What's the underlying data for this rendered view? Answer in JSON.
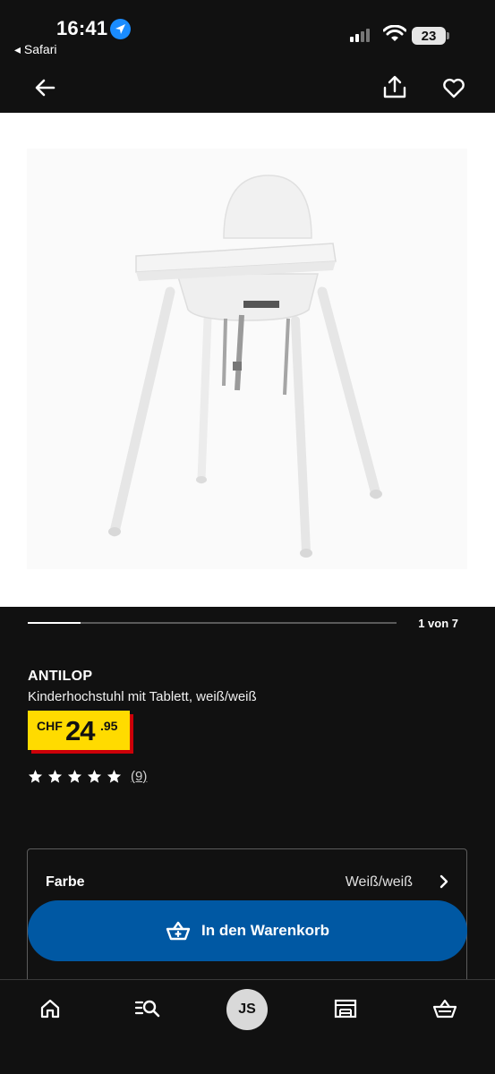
{
  "status_bar": {
    "time": "16:41",
    "back_app": "◂ Safari",
    "battery_level": "23",
    "icons": [
      "location-icon",
      "signal-icon",
      "wifi-icon",
      "battery-icon"
    ]
  },
  "top_nav": {
    "icons": [
      "back-arrow-icon",
      "share-icon",
      "heart-icon"
    ]
  },
  "gallery": {
    "image_subject": "white children's high chair with tray",
    "current_index": 1,
    "total": 7,
    "counter_text": "1 von 7",
    "progress_fraction": 0.143
  },
  "product": {
    "name": "ANTILOP",
    "description": "Kinderhochstuhl mit Tablett, weiß/weiß",
    "price": {
      "currency": "CHF",
      "integer": "24",
      "decimal": ".95"
    },
    "rating": {
      "stars": 5,
      "review_count": "(9)"
    }
  },
  "options": {
    "color_label": "Farbe",
    "color_value": "Weiß/weiß"
  },
  "cart_button": {
    "label": "In den Warenkorb",
    "icon": "basket-plus-icon"
  },
  "bottom_nav": {
    "avatar_initials": "JS",
    "items": [
      "home-icon",
      "search-menu-icon",
      "avatar",
      "store-icon",
      "basket-icon"
    ]
  },
  "colors": {
    "background": "#111111",
    "price_yellow": "#ffdb00",
    "price_shadow_red": "#cc0008",
    "button_blue": "#0058a3"
  }
}
